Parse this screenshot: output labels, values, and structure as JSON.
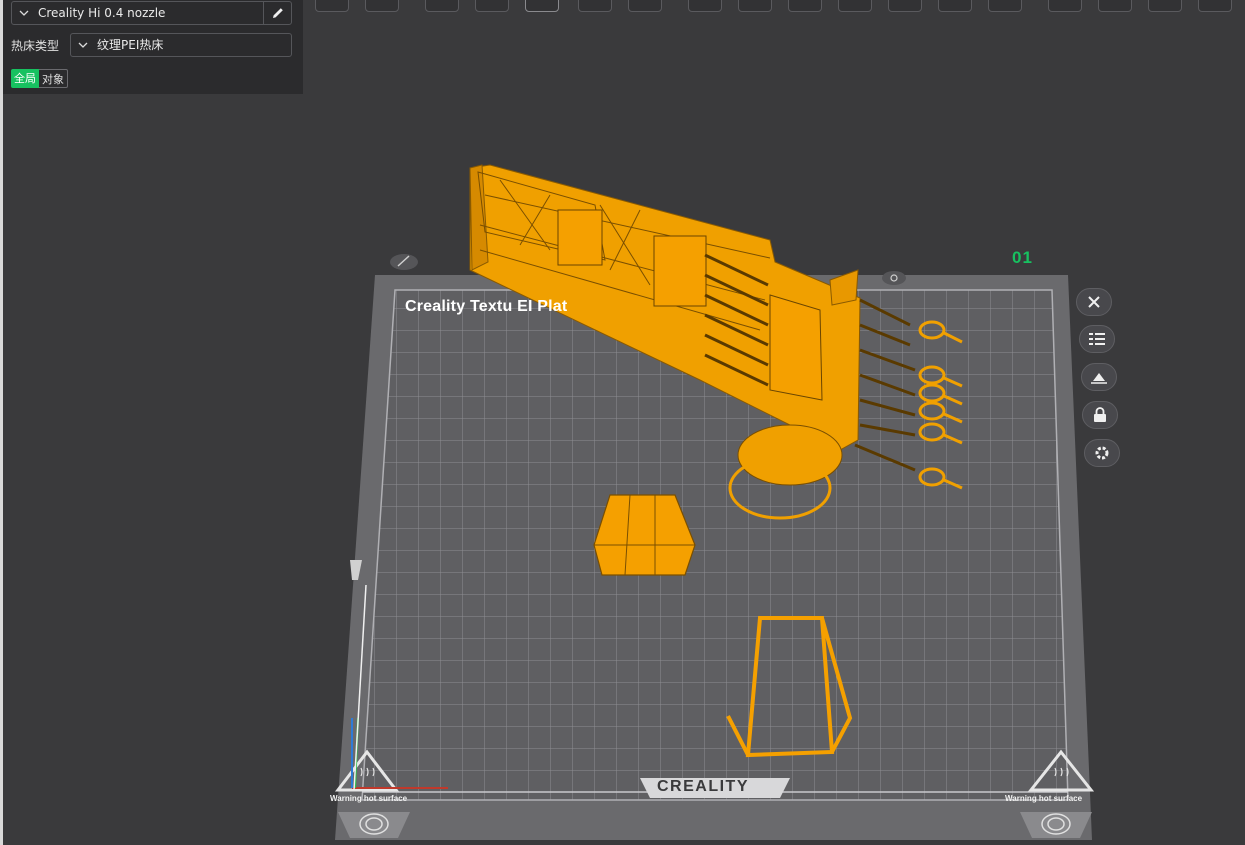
{
  "printer": {
    "name": "Creality Hi 0.4 nozzle"
  },
  "bed": {
    "label": "热床类型",
    "value": "纹理PEI热床"
  },
  "scope_toggle": {
    "global": "全局",
    "object": "对象",
    "active": "global"
  },
  "plate": {
    "label": "Creality Textu    EI Plat",
    "number": "01",
    "brand": "CREALITY",
    "warning_left": "Warning hot surface",
    "warning_right": "Warning hot surface"
  },
  "toolbar_icons": [
    "add-object-icon",
    "keyboard-icon",
    "cube-icon",
    "orient-icon",
    "arrange-icon",
    "layout-icon",
    "cut-icon",
    "split-objects-icon",
    "split-parts-icon",
    "support-icon",
    "variable-layer-icon",
    "seam-icon",
    "measure-icon",
    "text-icon",
    "assembly-icon",
    "mesh-icon",
    "fill-icon",
    "lines-icon",
    "view-icon"
  ],
  "side_buttons": [
    "close-icon",
    "list-icon",
    "auto-orient-icon",
    "lock-icon",
    "settings-icon"
  ],
  "colors": {
    "accent": "#17c160",
    "model": "#f5a000",
    "plate": "#6a6a6d",
    "grid": "#8e8e92"
  }
}
